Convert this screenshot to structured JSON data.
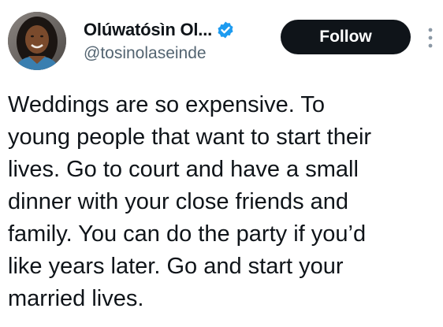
{
  "author": {
    "display_name": "Olúwatósìn Ol...",
    "handle": "@tosinolaseinde",
    "verified": true,
    "avatar_icon": "profile-photo"
  },
  "actions": {
    "follow_label": "Follow",
    "more_icon": "more-options-icon"
  },
  "tweet": {
    "text": "Weddings are so expensive. To\nyoung people that want to start their\nlives. Go to court and have a small\ndinner with your close friends and\nfamily. You can do the party if you’d\nlike years later. Go and start your\nmarried lives."
  },
  "colors": {
    "verified_badge": "#1d9bf0",
    "follow_button_bg": "#0f1419",
    "handle_text": "#536471"
  }
}
